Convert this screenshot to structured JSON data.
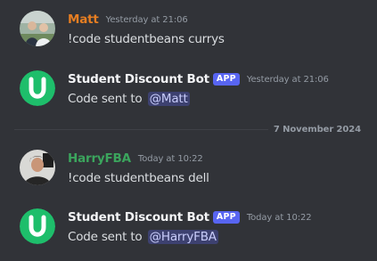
{
  "messages": [
    {
      "author": "Matt",
      "author_color": "#e67e22",
      "timestamp": "Yesterday at 21:06",
      "text": "!code studentbeans currys",
      "avatar_icon": "user-photo-avatar"
    },
    {
      "author": "Student Discount Bot",
      "badge": "APP",
      "timestamp": "Yesterday at 21:06",
      "text_prefix": "Code sent to ",
      "mention": "@Matt",
      "avatar_icon": "bot-u-logo-avatar",
      "avatar_color": "#1ebe6b"
    },
    {
      "author": "HarryFBA",
      "author_color": "#3ba55d",
      "timestamp": "Today at 10:22",
      "text": "!code studentbeans dell",
      "avatar_icon": "user-photo-avatar"
    },
    {
      "author": "Student Discount Bot",
      "badge": "APP",
      "timestamp": "Today at 10:22",
      "text_prefix": "Code sent to ",
      "mention": "@HarryFBA",
      "avatar_icon": "bot-u-logo-avatar",
      "avatar_color": "#1ebe6b"
    }
  ],
  "date_divider": "7 November 2024",
  "colors": {
    "background": "#313338",
    "badge": "#5865f2",
    "mention_bg": "rgba(88,101,242,0.3)",
    "mention_text": "#c9cdfb",
    "timestamp": "#949ba4"
  }
}
